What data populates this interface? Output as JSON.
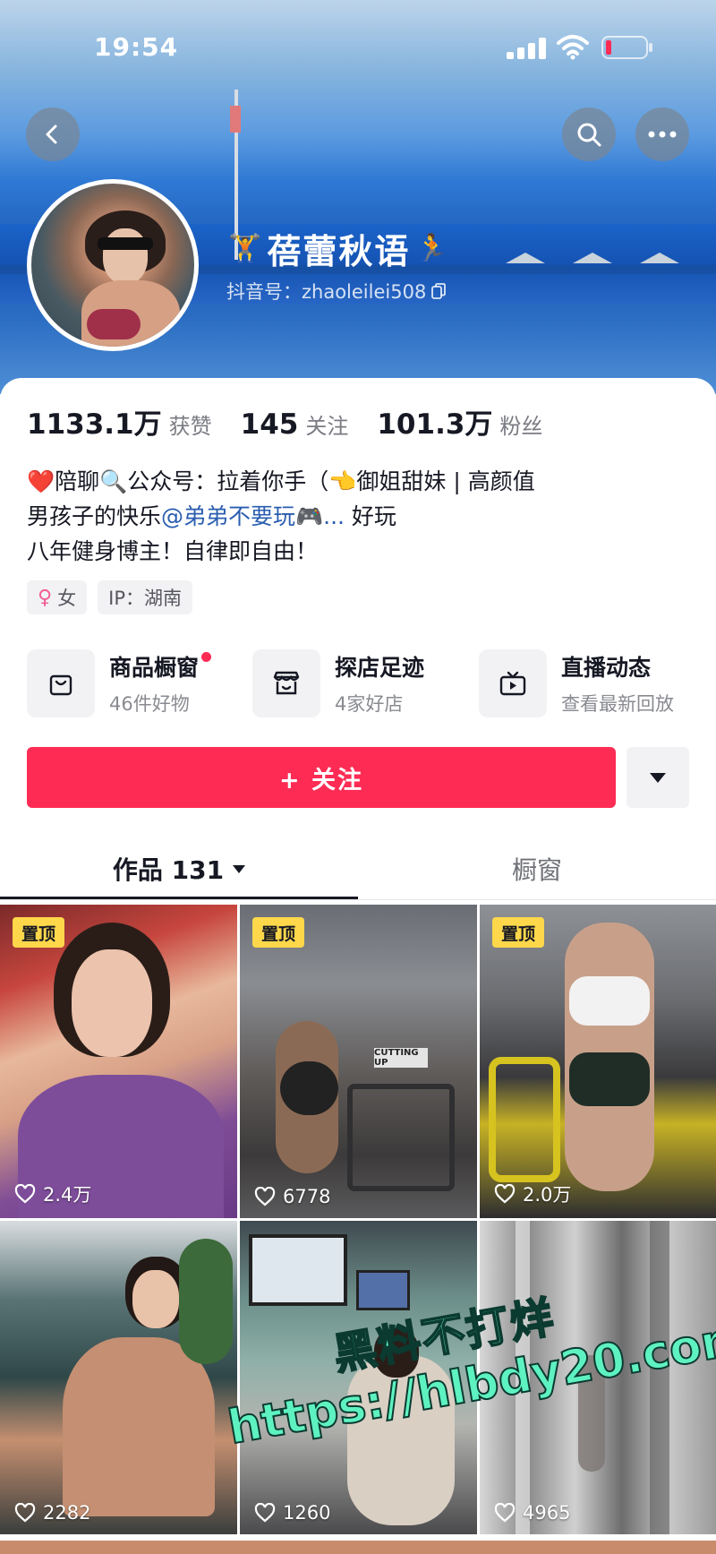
{
  "status_bar": {
    "time": "19:54",
    "icons": [
      "signal-icon",
      "wifi-icon",
      "battery-icon"
    ],
    "battery_color": "#fe2c55"
  },
  "header": {
    "back_icon": "chevron-left-icon",
    "search_icon": "search-icon",
    "more_icon": "more-dots-icon"
  },
  "profile": {
    "name_prefix_emoji": "🏋",
    "name": "蓓蕾秋语",
    "name_suffix_emoji": "🏃",
    "douyin_id": "抖音号：zhaoleilei508",
    "copy_icon": "copy-icon"
  },
  "stats": [
    {
      "value": "1133.1万",
      "label": "获赞"
    },
    {
      "value": "145",
      "label": "关注"
    },
    {
      "value": "101.3万",
      "label": "粉丝"
    }
  ],
  "bio": {
    "line1": "❤️陪聊🔍公众号：拉着你手（👈御姐甜妹 | 高颜值",
    "line2_prefix": "男孩子的快乐",
    "line2_mention": "@弟弟不要玩🎮...",
    "line2_suffix": " 好玩",
    "line3": "八年健身博主！自律即自由！"
  },
  "tags": {
    "gender": "女",
    "gender_icon": "female-icon",
    "ip": "IP：湖南"
  },
  "shortcuts": [
    {
      "title": "商品橱窗",
      "subtitle": "46件好物",
      "icon": "shopping-bag-icon",
      "has_dot": true
    },
    {
      "title": "探店足迹",
      "subtitle": "4家好店",
      "icon": "store-icon",
      "has_dot": false
    },
    {
      "title": "直播动态",
      "subtitle": "查看最新回放",
      "icon": "tv-icon",
      "has_dot": false
    }
  ],
  "actions": {
    "follow_label": "+ 关注",
    "dropdown_icon": "caret-down-icon"
  },
  "tabs": [
    {
      "label": "作品 131",
      "active": true
    },
    {
      "label": "橱窗",
      "active": false
    }
  ],
  "videos": [
    {
      "pinned": true,
      "pin_label": "置顶",
      "likes": "2.4万"
    },
    {
      "pinned": true,
      "pin_label": "置顶",
      "likes": "6778"
    },
    {
      "pinned": true,
      "pin_label": "置顶",
      "likes": "2.0万"
    },
    {
      "pinned": false,
      "pin_label": "",
      "likes": "2282"
    },
    {
      "pinned": false,
      "pin_label": "",
      "likes": "1260"
    },
    {
      "pinned": false,
      "pin_label": "",
      "likes": "4965"
    }
  ],
  "overlays": {
    "gym_sign": "CUTTING UP",
    "watermark_line1": "黑料不打烊",
    "watermark_line2": "https://hlbdy20.com"
  },
  "colors": {
    "accent": "#fe2c55",
    "pin_badge": "#fed84a",
    "mention": "#2a5db0",
    "watermark": "#5ef2c0"
  }
}
